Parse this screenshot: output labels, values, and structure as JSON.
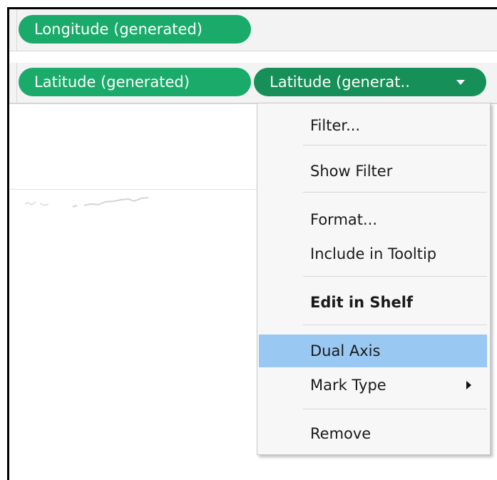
{
  "shelves": {
    "columns": {
      "pills": [
        {
          "label": "Longitude (generated)"
        }
      ]
    },
    "rows": {
      "pills": [
        {
          "label": "Latitude (generated)"
        },
        {
          "label": "Latitude (generat.."
        }
      ]
    }
  },
  "context_menu": {
    "items": [
      {
        "label": "Filter..."
      },
      {
        "label": "Show Filter"
      },
      {
        "label": "Format..."
      },
      {
        "label": "Include in Tooltip"
      },
      {
        "label": "Edit in Shelf"
      },
      {
        "label": "Dual Axis"
      },
      {
        "label": "Mark Type"
      },
      {
        "label": "Remove"
      }
    ],
    "highlighted": "Dual Axis"
  },
  "colors": {
    "pill_green": "#1aab6b",
    "pill_green_active": "#168f58",
    "menu_highlight": "#99c9f2"
  }
}
